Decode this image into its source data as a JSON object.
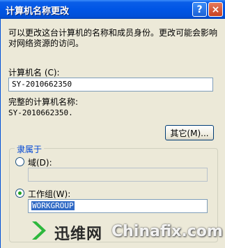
{
  "window": {
    "title": "计算机名称更改",
    "help_button": "?",
    "close_button": "×"
  },
  "description": "可以更改这台计算机的名称和成员身份。更改可能会影响对网络资源的访问。",
  "computer_name": {
    "label": "计算机名 (C):",
    "value": "SY-2010662350"
  },
  "full_name": {
    "label": "完整的计算机名称:",
    "value": "SY-2010662350."
  },
  "more_button": "其它(M)...",
  "member_of": {
    "title": "隶属于",
    "domain_label": "域(D):",
    "domain_value": "",
    "workgroup_label": "工作组(W):",
    "workgroup_value": "WORKGROUP",
    "selected": "workgroup"
  },
  "watermark": {
    "cn": "迅维网",
    "en": "Chinafix.com"
  },
  "colors": {
    "titlebar": "#0055e5",
    "dialog_bg": "#ece9d8",
    "group_title": "#0046d5",
    "selection": "#316ac5",
    "logo_green": "#2db83d"
  }
}
